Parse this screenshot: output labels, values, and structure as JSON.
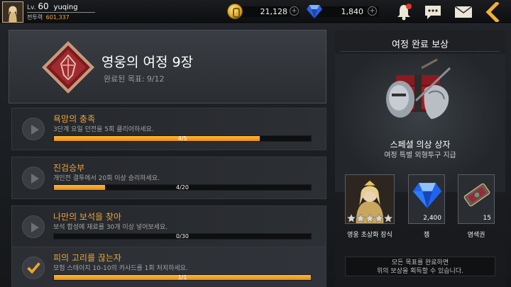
{
  "player": {
    "level_prefix": "Lv.",
    "level": "60",
    "name": "yuqing",
    "power_label": "전투력",
    "power_value": "601,337"
  },
  "currencies": {
    "gold": "21,128",
    "gems": "1,840",
    "plus": "+"
  },
  "chapter": {
    "title": "영웅의 여정 9장",
    "progress_label": "완료된 목표:",
    "progress_value": "9/12",
    "progress_fraction": 0.75
  },
  "quests": [
    {
      "title": "욕망의 충족",
      "desc": "3단계 요일 던전을 5회 클리어하세요.",
      "progress_text": "4/5",
      "progress": 0.8,
      "completed": false
    },
    {
      "title": "진검승부",
      "desc": "개인전 결투에서 20회 이상 승리하세요.",
      "progress_text": "4/20",
      "progress": 0.2,
      "completed": false
    },
    {
      "title": "나만의 보석을 찾아",
      "desc": "보석 합성에 재료를 30개 이상 넣어보세요.",
      "progress_text": "0/30",
      "progress": 0.0,
      "completed": false
    },
    {
      "title": "피의 고리를 끊는자",
      "desc": "모험 스테이지 10-10의 카사드를 1회 처치하세요.",
      "progress_text": "1/1",
      "progress": 1.0,
      "completed": true
    }
  ],
  "rewards": {
    "title": "여정 완료 보상",
    "main_name": "스페셜 의상 상자",
    "main_sub": "여정 특별 외형투구 지급",
    "items": [
      {
        "label": "영웅 초상화 장식",
        "count": "",
        "icon": "portrait-icon",
        "stars": 5
      },
      {
        "label": "젬",
        "count": "2,400",
        "icon": "gem-icon"
      },
      {
        "label": "염색권",
        "count": "15",
        "icon": "dye-ticket-icon"
      }
    ],
    "notice_line1": "모든 목표를 완료하면",
    "notice_line2": "위의 보상을 획득할 수 있습니다."
  },
  "colors": {
    "accent": "#f0a63a",
    "progress_fill": "#f5a524",
    "emblem": "#8a1f24"
  }
}
